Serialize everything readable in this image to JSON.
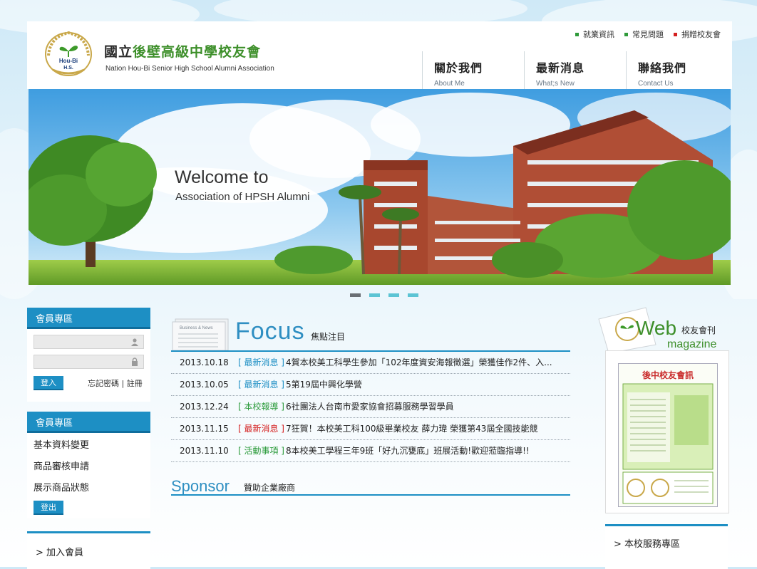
{
  "colors": {
    "accent": "#1d8fc4",
    "green": "#3d8f2a",
    "red_tag": "#d42020",
    "blue_tag": "#1d8fc4",
    "green_tag": "#2a9a3a"
  },
  "header": {
    "logo_text_1": "Hou-Bi",
    "logo_text_2": "H.S.",
    "title_prefix": "國立",
    "title_green": "後壁高級中學校友會",
    "subtitle": "Nation Hou-Bi Senior High School Alumni Association",
    "top_links": [
      {
        "label": "就業資訊",
        "color": "#2f9a3a"
      },
      {
        "label": "常見問題",
        "color": "#2f9a3a"
      },
      {
        "label": "捐贈校友會",
        "color": "#d42020"
      }
    ],
    "nav": [
      {
        "zh": "關於我們",
        "en": "About Me"
      },
      {
        "zh": "最新消息",
        "en": "What;s New"
      },
      {
        "zh": "聯絡我們",
        "en": "Contact Us"
      }
    ]
  },
  "banner": {
    "line1": "Welcome to",
    "line2": "Association of HPSH Alumni",
    "slides": 4,
    "active_slide": 0
  },
  "login": {
    "title": "會員專區",
    "username_placeholder": "",
    "password_placeholder": "",
    "login_label": "登入",
    "forgot_label": "忘記密碼",
    "separator": "|",
    "register_label": "註冊"
  },
  "member": {
    "title": "會員專區",
    "items": [
      "基本資料變更",
      "商品審核申請",
      "展示商品狀態"
    ],
    "logout_label": "登出"
  },
  "join": {
    "label": "> 加入會員"
  },
  "focus": {
    "heading": "Focus",
    "sub": "焦點注目",
    "paper_title": "Business & News",
    "news": [
      {
        "date": "2013.10.18",
        "category": "[ 最新消息 ]",
        "cat_color": "#1d8fc4",
        "title": "4賀本校美工科學生參加「102年度資安海報徵選」榮獲佳作2件、入..."
      },
      {
        "date": "2013.10.05",
        "category": "[ 最新消息 ]",
        "cat_color": "#1d8fc4",
        "title": "5第19屆中興化學營"
      },
      {
        "date": "2013.12.24",
        "category": "[ 本校報導 ]",
        "cat_color": "#2a9a3a",
        "title": "6社團法人台南市愛家協會招募服務學習學員"
      },
      {
        "date": "2013.11.15",
        "category": "[ 最新消息 ]",
        "cat_color": "#d42020",
        "title": "7狂賀！本校美工科100級畢業校友 薛力瑋 榮獲第43屆全國技能競"
      },
      {
        "date": "2013.11.10",
        "category": "[ 活動事項 ]",
        "cat_color": "#2a9a3a",
        "title": "8本校美工學程三年9班「好九沉甕底」班展活動!歡迎蒞臨指導!!"
      }
    ]
  },
  "sponsor": {
    "heading": "Sponsor",
    "sub": "贊助企業廠商"
  },
  "magazine": {
    "web": "Web",
    "zh": "校友會刊",
    "en": "magazine",
    "cover_title": "後中校友會訊"
  },
  "service": {
    "label": "> 本校服務專區"
  }
}
